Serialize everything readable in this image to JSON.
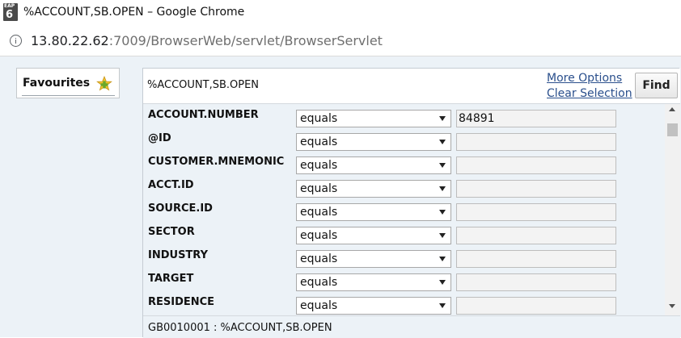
{
  "window": {
    "title": "%ACCOUNT,SB.OPEN – Google Chrome",
    "icon_top": "EAP",
    "icon_bottom": "6"
  },
  "address": {
    "host": "13.80.22.62",
    "path": ":7009/BrowserWeb/servlet/BrowserServlet"
  },
  "favourites": {
    "label": "Favourites"
  },
  "enquiry": {
    "title": "%ACCOUNT,SB.OPEN",
    "more_options": "More Options",
    "clear_selection": "Clear Selection",
    "find_label": "Find"
  },
  "selection_rows": [
    {
      "field": "ACCOUNT.NUMBER",
      "operator": "equals",
      "value": "84891"
    },
    {
      "field": "@ID",
      "operator": "equals",
      "value": ""
    },
    {
      "field": "CUSTOMER.MNEMONIC",
      "operator": "equals",
      "value": ""
    },
    {
      "field": "ACCT.ID",
      "operator": "equals",
      "value": ""
    },
    {
      "field": "SOURCE.ID",
      "operator": "equals",
      "value": ""
    },
    {
      "field": "SECTOR",
      "operator": "equals",
      "value": ""
    },
    {
      "field": "INDUSTRY",
      "operator": "equals",
      "value": ""
    },
    {
      "field": "TARGET",
      "operator": "equals",
      "value": ""
    },
    {
      "field": "RESIDENCE",
      "operator": "equals",
      "value": ""
    }
  ],
  "status": {
    "text": "GB0010001 : %ACCOUNT,SB.OPEN"
  },
  "colors": {
    "link": "#2a4f8c",
    "panel_bg": "#ecf2f7",
    "favourites_add": "#6aa82a"
  }
}
